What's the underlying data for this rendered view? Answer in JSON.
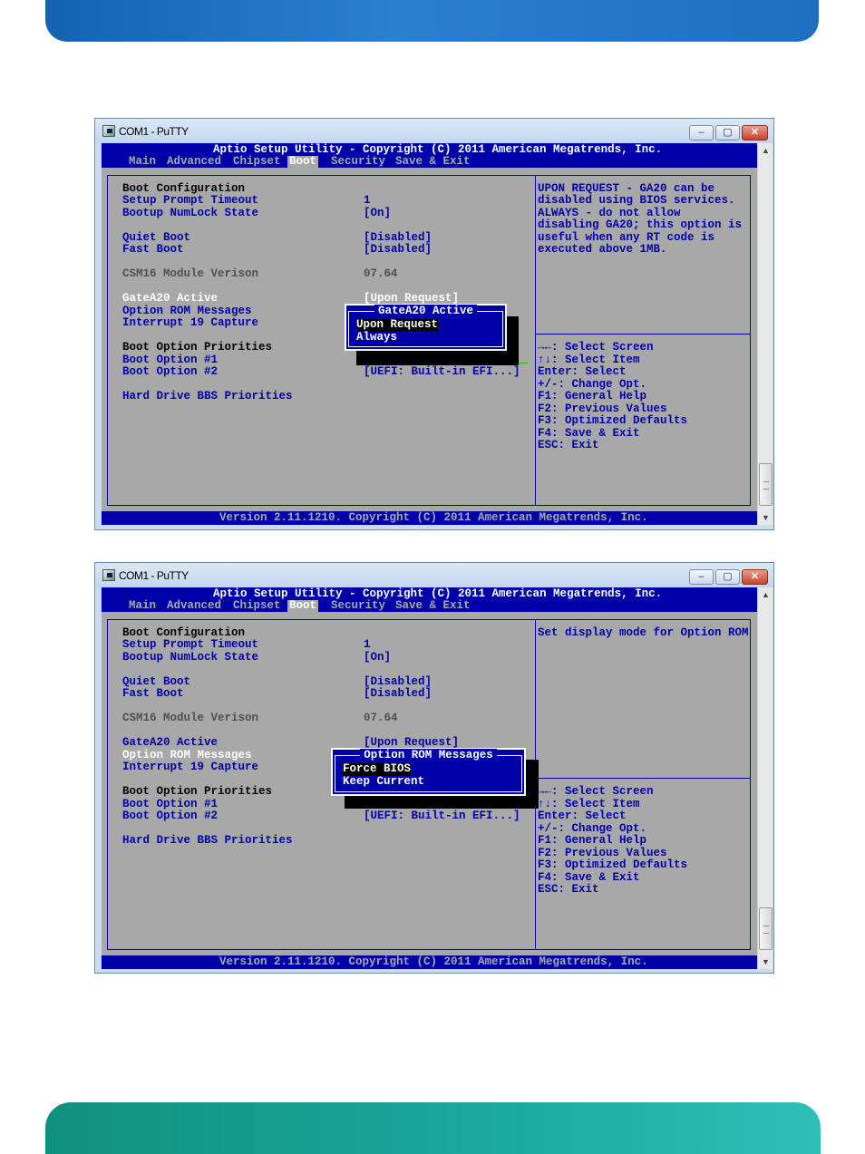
{
  "colors": {
    "header_band": "#1f6ec2",
    "footer_band": "#19a89b",
    "bios_blue": "#0000a8",
    "bios_grey": "#a8a8a8"
  },
  "window_title": "COM1 - PuTTY",
  "window_buttons": {
    "minimize": "–",
    "maximize": "▢",
    "close": "✕"
  },
  "scroll": {
    "up": "▲",
    "down": "▼"
  },
  "bios": {
    "title": "Aptio Setup Utility - Copyright (C) 2011 American Megatrends, Inc.",
    "tabs": [
      "Main",
      "Advanced",
      "Chipset",
      "Boot",
      "Security",
      "Save & Exit"
    ],
    "active_tab": "Boot",
    "version": "Version 2.11.1210. Copyright (C) 2011 American Megatrends, Inc.",
    "items": [
      {
        "label": "Boot Configuration",
        "value": ""
      },
      {
        "label": "Setup Prompt Timeout",
        "value": "1"
      },
      {
        "label": "Bootup NumLock State",
        "value": "[On]"
      },
      {
        "label": "Quiet Boot",
        "value": "[Disabled]"
      },
      {
        "label": "Fast Boot",
        "value": "[Disabled]"
      },
      {
        "label": "CSM16 Module Verison",
        "value": "07.64"
      },
      {
        "label": "GateA20 Active",
        "value": "[Upon Request]"
      },
      {
        "label": "Option ROM Messages",
        "value": ""
      },
      {
        "label": "Interrupt 19 Capture",
        "value": ""
      },
      {
        "label": "Boot Option Priorities",
        "value": ""
      },
      {
        "label": "Boot Option #1",
        "value": ""
      },
      {
        "label": "Boot Option #2",
        "value": "[UEFI: Built-in EFI...]"
      },
      {
        "label": "Hard Drive BBS Priorities",
        "value": ""
      }
    ],
    "keys": [
      "→←: Select Screen",
      "↑↓: Select Item",
      "Enter: Select",
      "+/-: Change Opt.",
      "F1: General Help",
      "F2: Previous Values",
      "F3: Optimized Defaults",
      "F4: Save & Exit",
      "ESC: Exit"
    ]
  },
  "screens": [
    {
      "help": [
        "UPON REQUEST - GA20 can be",
        "disabled using BIOS services.",
        "ALWAYS - do not allow",
        "disabling GA20; this option is",
        "useful when any RT code is",
        "executed above 1MB."
      ],
      "popup": {
        "title": "GateA20 Active",
        "options": [
          "Upon Request",
          "Always"
        ],
        "selected": "Upon Request"
      }
    },
    {
      "help": [
        "Set display mode for Option ROM"
      ],
      "popup": {
        "title": "Option ROM Messages",
        "options": [
          "Force BIOS",
          "Keep Current"
        ],
        "selected": "Force BIOS"
      }
    }
  ]
}
